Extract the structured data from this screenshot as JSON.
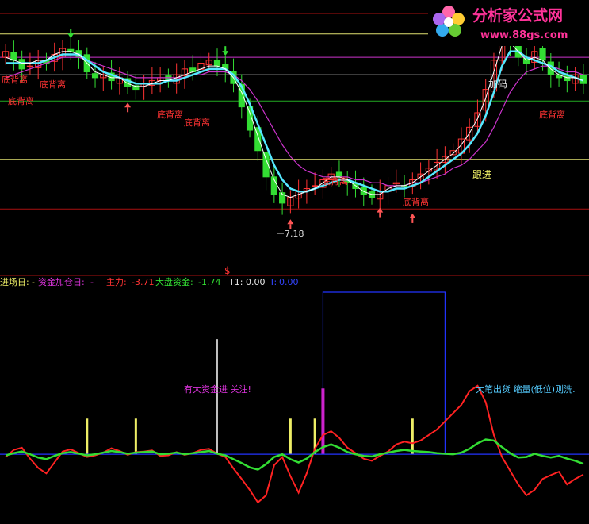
{
  "watermark": {
    "name": "分析家公式网",
    "url": "www.88gs.com"
  },
  "colors": {
    "background": "#000000",
    "up_candle": "#ff3333",
    "down_candle": "#33dd33",
    "ma_fast": "#ffffff",
    "ma_mid": "#55e8ff",
    "ma_slow": "#cc33cc",
    "zhuli_line": "#ff2222",
    "dapan_line": "#33dd33",
    "box": "#2233ff",
    "hline_red": "#aa1111",
    "hline_yellow": "#e0e070",
    "hline_magenta": "#cc33cc",
    "hline_white": "#eeeeee",
    "hline_green": "#22aa22",
    "marker_yellow": "#eeee66",
    "marker_magenta": "#cc22cc"
  },
  "upper_panel": {
    "annotations": {
      "bottom_divergence": "底背离",
      "add_position": "加码",
      "follow_in": "跟进",
      "low_value": "7.18",
      "dollar": "$"
    }
  },
  "lower_panel": {
    "header": {
      "entry_day": {
        "label": "进场日:",
        "value": "-"
      },
      "fund_add_day": {
        "label": "资金加仓日:",
        "value": "-"
      },
      "zhuli": {
        "label": "主力:",
        "value": "-3.71"
      },
      "dapan": {
        "label": "大盘资金:",
        "value": "-1.74"
      },
      "t1": {
        "label": "T1:",
        "value": "0.00"
      },
      "t": {
        "label": "T:",
        "value": "0.00"
      }
    },
    "notes": {
      "big_money": "有大资金进 关注!",
      "big_sell": "大笔出货 缩量(低位)则洗."
    }
  },
  "chart_data": [
    {
      "type": "candlestick",
      "panel": "price",
      "series": [
        {
          "kind": "close",
          "values": [
            12.9,
            12.6,
            12.3,
            12.4,
            12.6,
            12.5,
            12.8,
            13.0,
            12.9,
            12.7,
            12.2,
            12.0,
            12.1,
            11.9,
            12.0,
            11.7,
            11.6,
            11.8,
            11.9,
            12.0,
            11.9,
            12.1,
            12.3,
            12.2,
            12.5,
            12.6,
            12.4,
            12.3,
            11.8,
            11.0,
            10.2,
            9.5,
            8.6,
            8.0,
            7.7,
            7.9,
            8.1,
            8.2,
            8.3,
            8.5,
            8.7,
            8.6,
            8.4,
            8.2,
            8.0,
            7.9,
            8.1,
            8.3,
            8.4,
            8.3,
            8.5,
            8.7,
            8.9,
            9.1,
            9.3,
            9.5,
            9.9,
            10.3,
            10.8,
            11.6,
            12.6,
            13.5,
            13.2,
            12.7,
            12.5,
            12.9,
            12.6,
            12.1,
            12.0,
            11.9,
            12.1,
            11.8
          ]
        },
        {
          "kind": "ma_fast",
          "values": [
            12.7,
            12.6,
            12.5,
            12.5,
            12.6,
            12.6,
            12.8,
            12.9,
            12.9,
            12.8,
            12.5,
            12.2,
            12.1,
            12.0,
            12.0,
            11.8,
            11.7,
            11.7,
            11.8,
            11.9,
            11.9,
            12.0,
            12.1,
            12.2,
            12.3,
            12.4,
            12.4,
            12.3,
            12.0,
            11.5,
            10.8,
            10.0,
            9.2,
            8.5,
            8.0,
            7.9,
            8.0,
            8.1,
            8.2,
            8.4,
            8.6,
            8.6,
            8.5,
            8.3,
            8.1,
            8.0,
            8.0,
            8.2,
            8.3,
            8.3,
            8.4,
            8.6,
            8.8,
            9.0,
            9.2,
            9.4,
            9.7,
            10.1,
            10.6,
            11.3,
            12.2,
            13.1,
            13.2,
            12.9,
            12.6,
            12.7,
            12.6,
            12.3,
            12.1,
            12.0,
            12.0,
            11.9
          ]
        },
        {
          "kind": "ma_mid",
          "values": [
            12.5,
            12.5,
            12.5,
            12.5,
            12.5,
            12.6,
            12.7,
            12.8,
            12.8,
            12.8,
            12.6,
            12.4,
            12.2,
            12.1,
            12.0,
            11.9,
            11.8,
            11.8,
            11.8,
            11.8,
            11.9,
            11.9,
            12.0,
            12.1,
            12.2,
            12.3,
            12.3,
            12.3,
            12.1,
            11.7,
            11.1,
            10.4,
            9.7,
            9.0,
            8.5,
            8.2,
            8.1,
            8.1,
            8.2,
            8.3,
            8.4,
            8.5,
            8.5,
            8.4,
            8.3,
            8.2,
            8.1,
            8.1,
            8.2,
            8.2,
            8.3,
            8.4,
            8.6,
            8.8,
            9.0,
            9.2,
            9.4,
            9.7,
            10.1,
            10.7,
            11.5,
            12.4,
            12.9,
            12.9,
            12.7,
            12.6,
            12.5,
            12.4,
            12.2,
            12.1,
            12.0,
            11.9
          ]
        },
        {
          "kind": "ma_slow",
          "values": [
            12.0,
            12.1,
            12.2,
            12.3,
            12.4,
            12.5,
            12.6,
            12.7,
            12.7,
            12.7,
            12.6,
            12.5,
            12.4,
            12.3,
            12.2,
            12.1,
            12.0,
            12.0,
            12.0,
            12.0,
            12.0,
            12.0,
            12.0,
            12.1,
            12.1,
            12.2,
            12.2,
            12.2,
            12.1,
            11.9,
            11.6,
            11.2,
            10.7,
            10.2,
            9.7,
            9.3,
            9.0,
            8.8,
            8.7,
            8.6,
            8.6,
            8.6,
            8.6,
            8.5,
            8.5,
            8.4,
            8.4,
            8.3,
            8.3,
            8.3,
            8.4,
            8.4,
            8.5,
            8.6,
            8.7,
            8.9,
            9.0,
            9.2,
            9.5,
            9.8,
            10.3,
            10.9,
            11.5,
            11.9,
            12.2,
            12.3,
            12.4,
            12.4,
            12.3,
            12.2,
            12.2,
            12.1
          ]
        }
      ],
      "ylim": [
        6.5,
        14.5
      ],
      "hlines": [
        14.2,
        13.5,
        12.7,
        12.1,
        11.2,
        9.2,
        7.5
      ]
    },
    {
      "type": "line",
      "panel": "fund_flow",
      "series": [
        {
          "name": "主力",
          "values": [
            -0.5,
            0.8,
            1.2,
            -0.8,
            -2.5,
            -3.5,
            -1.5,
            0.5,
            0.9,
            0.2,
            -0.5,
            -0.2,
            0.3,
            1.1,
            0.6,
            -0.1,
            0.4,
            0.5,
            0.7,
            -0.3,
            -0.2,
            0.4,
            -0.1,
            0.2,
            0.8,
            1.0,
            0.1,
            -0.5,
            -2.6,
            -4.5,
            -6.5,
            -8.8,
            -7.5,
            -2.0,
            -0.5,
            -4.0,
            -7.0,
            -3.5,
            1.0,
            3.5,
            4.2,
            3.0,
            1.2,
            0.2,
            -0.8,
            -1.2,
            -0.3,
            0.5,
            1.8,
            2.3,
            2.0,
            2.5,
            3.5,
            4.5,
            6.0,
            7.5,
            9.0,
            11.5,
            12.5,
            9.5,
            3.5,
            -0.5,
            -3.0,
            -5.5,
            -7.5,
            -6.5,
            -4.5,
            -3.8,
            -3.2,
            -5.5,
            -4.5,
            -3.71
          ]
        },
        {
          "name": "大盘资金",
          "values": [
            -0.2,
            0.2,
            0.5,
            0.0,
            -0.6,
            -0.9,
            -0.3,
            0.2,
            0.4,
            0.1,
            -0.2,
            0.0,
            0.3,
            0.6,
            0.4,
            0.1,
            0.3,
            0.4,
            0.5,
            0.0,
            0.1,
            0.3,
            0.0,
            0.2,
            0.4,
            0.6,
            0.1,
            -0.2,
            -0.9,
            -1.6,
            -2.4,
            -2.8,
            -1.8,
            -0.5,
            0.0,
            -0.9,
            -1.5,
            -0.8,
            0.4,
            1.3,
            1.8,
            1.2,
            0.4,
            0.0,
            -0.3,
            -0.4,
            0.0,
            0.3,
            0.6,
            0.8,
            0.6,
            0.5,
            0.4,
            0.2,
            0.1,
            0.0,
            0.3,
            1.0,
            2.0,
            2.7,
            2.5,
            1.3,
            0.2,
            -0.6,
            -0.5,
            0.1,
            -0.3,
            -0.6,
            -0.3,
            -0.8,
            -1.2,
            -1.74
          ]
        }
      ],
      "signal_bars": [
        {
          "x": 10,
          "value": 6.5,
          "color": "yellow"
        },
        {
          "x": 16,
          "value": 6.5,
          "color": "yellow"
        },
        {
          "x": 26,
          "value": 21.0,
          "color": "white"
        },
        {
          "x": 35,
          "value": 6.5,
          "color": "yellow"
        },
        {
          "x": 38,
          "value": 6.5,
          "color": "yellow"
        },
        {
          "x": 39,
          "value": 12.0,
          "color": "magenta"
        },
        {
          "x": 50,
          "value": 6.5,
          "color": "yellow"
        }
      ],
      "box": {
        "x_start": 39,
        "x_end": 54
      },
      "ylim": [
        -12,
        30
      ]
    }
  ]
}
